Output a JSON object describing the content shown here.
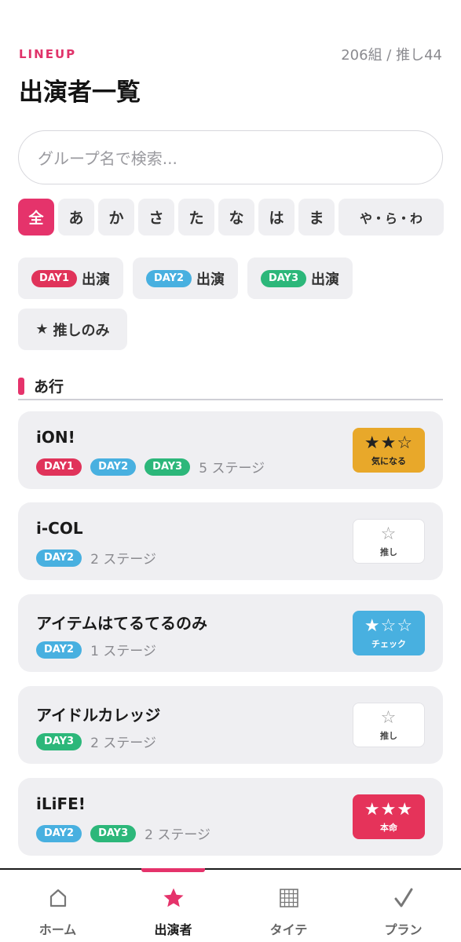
{
  "header": {
    "eyebrow": "LINEUP",
    "count": "206組 / 推し44",
    "title": "出演者一覧"
  },
  "search": {
    "placeholder": "グループ名で検索..."
  },
  "kana_filters": [
    {
      "label": "全",
      "active": true
    },
    {
      "label": "あ"
    },
    {
      "label": "か"
    },
    {
      "label": "さ"
    },
    {
      "label": "た"
    },
    {
      "label": "な"
    },
    {
      "label": "は"
    },
    {
      "label": "ま"
    },
    {
      "label": "や・ら・わ"
    }
  ],
  "day_filters": [
    {
      "tag": "DAY1",
      "label": "出演",
      "color": "#e0335a"
    },
    {
      "tag": "DAY2",
      "label": "出演",
      "color": "#48b0e0"
    },
    {
      "tag": "DAY3",
      "label": "出演",
      "color": "#2cb77a"
    }
  ],
  "oshi_filter": {
    "icon": "★",
    "label": "推しのみ"
  },
  "section": {
    "label": "あ行"
  },
  "day_colors": {
    "DAY1": "#e0335a",
    "DAY2": "#48b0e0",
    "DAY3": "#2cb77a"
  },
  "artists": [
    {
      "name": "iON!",
      "days": [
        "DAY1",
        "DAY2",
        "DAY3"
      ],
      "stages": "5 ステージ",
      "rating": {
        "stars": "★★☆",
        "label": "気になる",
        "level": 2,
        "color": "#e8a82a"
      }
    },
    {
      "name": "i-COL",
      "days": [
        "DAY2"
      ],
      "stages": "2 ステージ",
      "rating": {
        "stars": "☆",
        "label": "推し",
        "level": 0,
        "color": "#ffffff"
      }
    },
    {
      "name": "アイテムはてるてるのみ",
      "days": [
        "DAY2"
      ],
      "stages": "1 ステージ",
      "rating": {
        "stars": "★☆☆",
        "label": "チェック",
        "level": 1,
        "color": "#48b0e0"
      }
    },
    {
      "name": "アイドルカレッジ",
      "days": [
        "DAY3"
      ],
      "stages": "2 ステージ",
      "rating": {
        "stars": "☆",
        "label": "推し",
        "level": 0,
        "color": "#ffffff"
      }
    },
    {
      "name": "iLiFE!",
      "days": [
        "DAY2",
        "DAY3"
      ],
      "stages": "2 ステージ",
      "rating": {
        "stars": "★★★",
        "label": "本命",
        "level": 3,
        "color": "#e5335a"
      }
    }
  ],
  "nav": [
    {
      "label": "ホーム",
      "icon": "home-icon"
    },
    {
      "label": "出演者",
      "icon": "star-icon",
      "active": true
    },
    {
      "label": "タイテ",
      "icon": "grid-icon"
    },
    {
      "label": "プラン",
      "icon": "check-icon"
    }
  ],
  "accent": "#e5336b"
}
